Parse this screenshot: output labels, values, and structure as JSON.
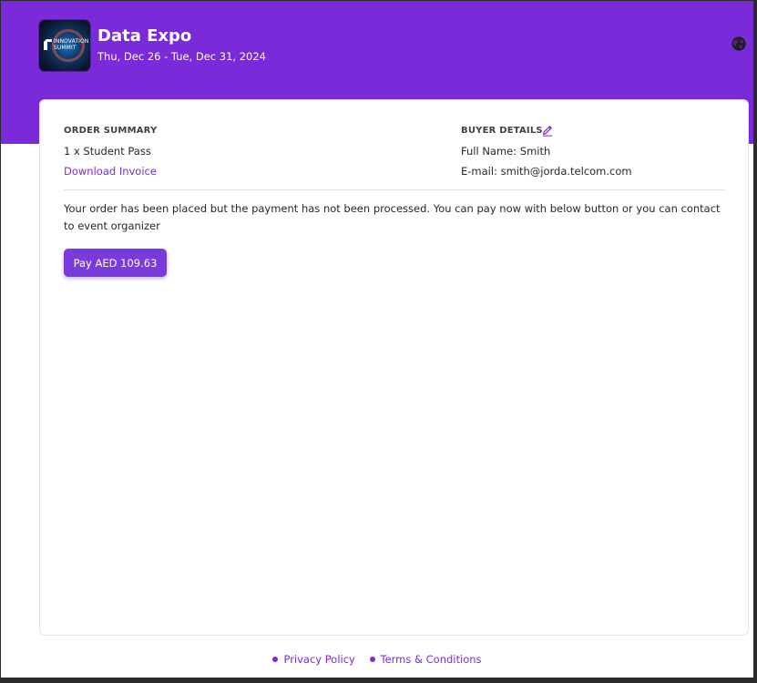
{
  "event": {
    "title": "Data Expo",
    "dates": "Thu, Dec 26 - Tue, Dec 31, 2024",
    "logo_text_line1": "INNOVATION",
    "logo_text_line2": "SUMMIT"
  },
  "order_summary": {
    "heading": "ORDER SUMMARY",
    "item": "1 x Student Pass",
    "download_label": "Download Invoice"
  },
  "buyer_details": {
    "heading": "BUYER DETAILS",
    "full_name_label": "Full Name:",
    "full_name": "Smith",
    "email_label": "E-mail:",
    "email": "smith@jorda.telcom.com"
  },
  "message": "Your order has been placed but the payment has not been processed. You can pay now with below button or you can contact to event organizer",
  "pay_button_label": "Pay AED 109.63",
  "footer": {
    "privacy": "Privacy Policy",
    "terms": "Terms & Conditions"
  },
  "colors": {
    "brand": "#7b2ad9",
    "button": "#7b3bdc"
  },
  "icons": {
    "language": "globe-icon",
    "edit": "pencil-edit-icon"
  }
}
